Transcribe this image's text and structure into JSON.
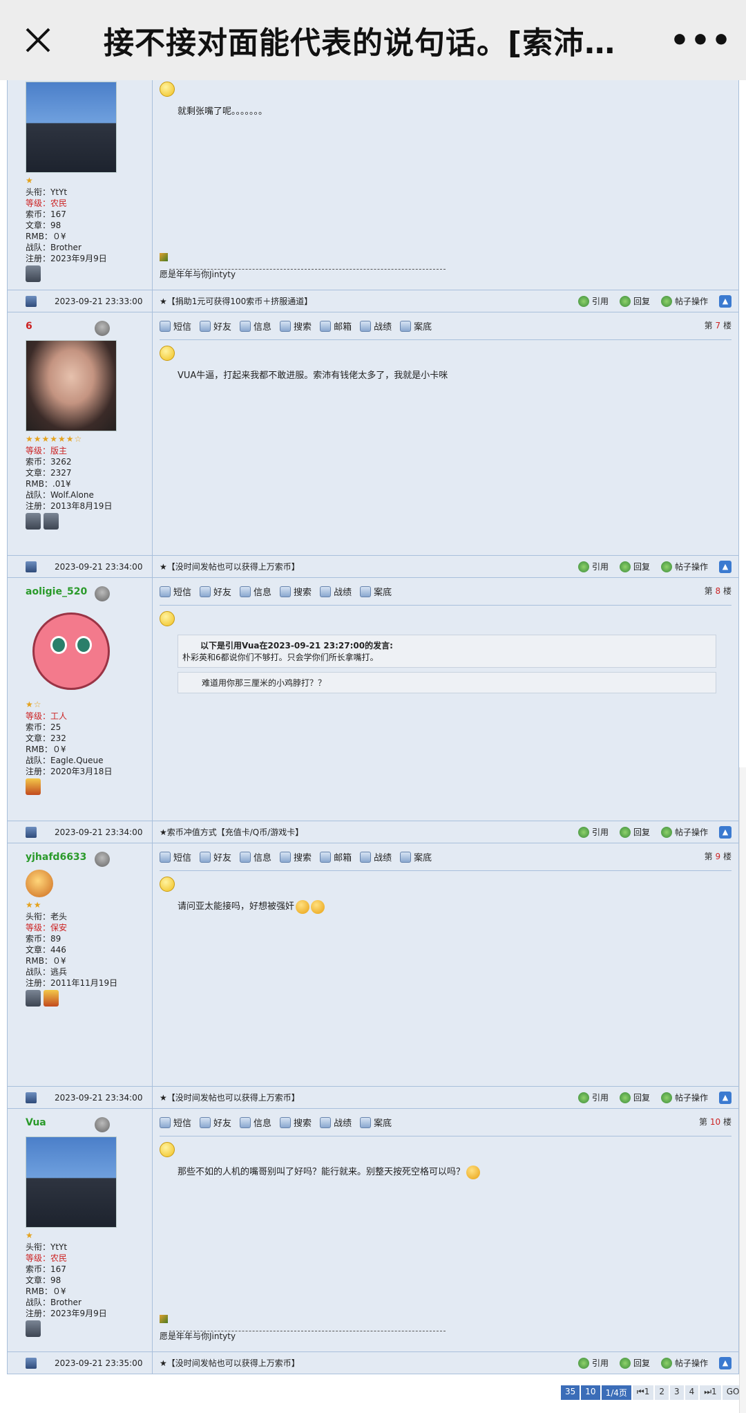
{
  "app_bar": {
    "title": "接不接对面能代表的说句话。[索沛…",
    "more_label": "•••"
  },
  "posts": [
    {
      "top_partial": true,
      "content": "就剩张嘴了呢。。。。。。。",
      "user": {
        "stars": "★",
        "title_line": "头衔：YtYt",
        "level_label": "等级：",
        "level": "农民",
        "coins": "索币：167",
        "articles": "文章：98",
        "rmb": "RMB：０¥",
        "team": "战队：Brother",
        "reg": "注册：2023年9月9日"
      },
      "signature": "愿是年年与你Jintyty"
    },
    {
      "name": "6",
      "floor_prefix": "第",
      "floor_num": "7",
      "floor_suffix": "楼",
      "content": "VUA牛逼，打起来我都不敢进服。索沛有钱佬太多了，我就是小卡咪",
      "user": {
        "stars": "★★★★★★☆",
        "level_label": "等级：",
        "level": "版主",
        "coins": "索币：3262",
        "articles": "文章：2327",
        "rmb": "RMB：.01¥",
        "team": "战队：Wolf.Alone",
        "reg": "注册：2013年8月19日"
      }
    },
    {
      "name": "aoligie_520",
      "floor_prefix": "第",
      "floor_num": "8",
      "floor_suffix": "楼",
      "quote_header": "以下是引用Vua在2023-09-21 23:27:00的发言:",
      "quote_body": "朴彩英和6都说你们不够打。只会学你们所长拿嘴打。",
      "content": "难道用你那三厘米的小鸡脖打？？",
      "user": {
        "stars": "★☆",
        "level_label": "等级：",
        "level": "工人",
        "coins": "索币：25",
        "articles": "文章：232",
        "rmb": "RMB：０¥",
        "team": "战队：Eagle.Queue",
        "reg": "注册：2020年3月18日"
      }
    },
    {
      "name": "yjhafd6633",
      "floor_prefix": "第",
      "floor_num": "9",
      "floor_suffix": "楼",
      "content": "请问亚太能接吗，好想被强奸",
      "user": {
        "stars": "★★",
        "title_line": "头衔：老头",
        "level_label": "等级：",
        "level": "保安",
        "coins": "索币：89",
        "articles": "文章：446",
        "rmb": "RMB：０¥",
        "team": "战队：逃兵",
        "reg": "注册：2011年11月19日"
      }
    },
    {
      "name": "Vua",
      "floor_prefix": "第",
      "floor_num": "10",
      "floor_suffix": "楼",
      "content": "那些不如的人机的嘴哥别叫了好吗？能行就来。别整天按死空格可以吗？",
      "user": {
        "stars": "★",
        "title_line": "头衔：YtYt",
        "level_label": "等级：",
        "level": "农民",
        "coins": "索币：167",
        "articles": "文章：98",
        "rmb": "RMB：０¥",
        "team": "战队：Brother",
        "reg": "注册：2023年9月9日"
      },
      "signature": "愿是年年与你Jintyty"
    }
  ],
  "footers": [
    {
      "time": "2023-09-21 23:33:00",
      "ad": "★【捐助1元可获得100索币＋挤服通道】"
    },
    {
      "time": "2023-09-21 23:34:00",
      "ad": "★【没时间发帖也可以获得上万索币】"
    },
    {
      "time": "2023-09-21 23:34:00",
      "ad": "★索币冲值方式【充值卡/Q币/游戏卡】"
    },
    {
      "time": "2023-09-21 23:34:00",
      "ad": "★【没时间发帖也可以获得上万索币】"
    },
    {
      "time": "2023-09-21 23:35:00",
      "ad": "★【没时间发帖也可以获得上万索币】"
    }
  ],
  "toolbar": {
    "sms": "短信",
    "friend": "好友",
    "info": "信息",
    "search": "搜索",
    "mail": "邮箱",
    "record": "战绩",
    "case": "案底"
  },
  "footer_ops": {
    "quote": "引用",
    "reply": "回复",
    "manage": "帖子操作"
  },
  "pager": [
    "35",
    "10",
    "1/4页",
    "⏮1",
    "2",
    "3",
    "4",
    "⏭1",
    "GO"
  ]
}
